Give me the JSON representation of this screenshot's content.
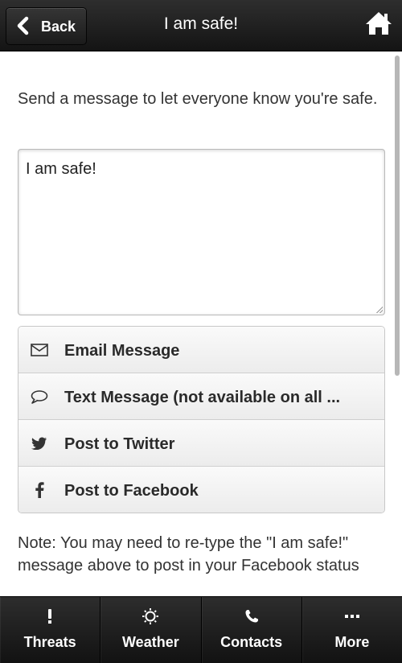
{
  "header": {
    "back_label": "Back",
    "title": "I am safe!",
    "home_icon": "home-icon"
  },
  "content": {
    "intro": "Send a message to let everyone know you're safe.",
    "message_value": "I am safe!",
    "share_options": [
      {
        "label": "Email Message",
        "icon": "envelope-icon"
      },
      {
        "label": "Text Message (not available on all ...",
        "icon": "speech-bubble-icon"
      },
      {
        "label": "Post to Twitter",
        "icon": "twitter-icon"
      },
      {
        "label": "Post to Facebook",
        "icon": "facebook-icon"
      }
    ],
    "note": "Note: You may need to re-type the \"I am safe!\" message above to post in your Facebook status"
  },
  "tabbar": {
    "tabs": [
      {
        "label": "Threats",
        "icon": "exclamation-icon"
      },
      {
        "label": "Weather",
        "icon": "sun-icon"
      },
      {
        "label": "Contacts",
        "icon": "phone-icon"
      },
      {
        "label": "More",
        "icon": "ellipsis-icon"
      }
    ]
  },
  "colors": {
    "bar_background": "#1e1e1e",
    "content_background": "#ffffff",
    "text": "#333333"
  }
}
